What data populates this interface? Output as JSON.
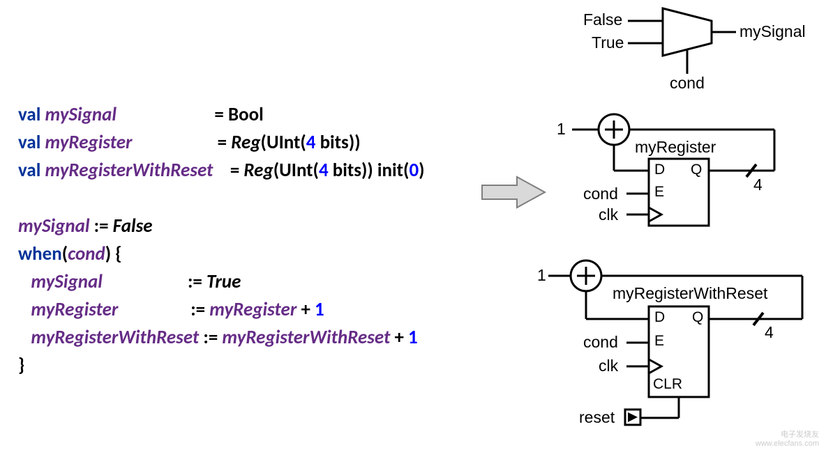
{
  "code": {
    "l1_kw": "val",
    "l1_id": "mySignal",
    "l1_rhs": "Bool",
    "l2_kw": "val",
    "l2_id": "myRegister",
    "l2_t": "Reg",
    "l2_p1": "(UInt(",
    "l2_n": "4",
    "l2_p2": " bits))",
    "l3_kw": "val",
    "l3_id": "myRegisterWithReset",
    "l3_t": "Reg",
    "l3_p1": "(UInt(",
    "l3_n": "4",
    "l3_p2": " bits)) init(",
    "l3_z": "0",
    "l3_p3": ")",
    "l4_id": "mySignal",
    "l4_op": ":=",
    "l4_v": "False",
    "l5_kw": "when",
    "l5_p1": "(",
    "l5_c": "cond",
    "l5_p2": ") {",
    "l6_id": "mySignal",
    "l6_op": ":=",
    "l6_v": "True",
    "l7_id": "myRegister",
    "l7_op": ":=",
    "l7_r": "myRegister",
    "l7_pl": "+",
    "l7_n": "1",
    "l8_id": "myRegisterWithReset",
    "l8_op": ":=",
    "l8_r": "myRegisterWithReset",
    "l8_pl": "+",
    "l8_n": "1",
    "l9": "}"
  },
  "d": {
    "mux_false": "False",
    "mux_true": "True",
    "mux_out": "mySignal",
    "mux_sel": "cond",
    "r1_one": "1",
    "r1_name": "myRegister",
    "r1_D": "D",
    "r1_Q": "Q",
    "r1_E": "E",
    "r1_cond": "cond",
    "r1_clk": "clk",
    "r1_w": "4",
    "r2_one": "1",
    "r2_name": "myRegisterWithReset",
    "r2_D": "D",
    "r2_Q": "Q",
    "r2_E": "E",
    "r2_CLR": "CLR",
    "r2_cond": "cond",
    "r2_clk": "clk",
    "r2_reset": "reset",
    "r2_w": "4"
  },
  "wm_l1": "电子发烧友",
  "wm_l2": "www.elecfans.com"
}
